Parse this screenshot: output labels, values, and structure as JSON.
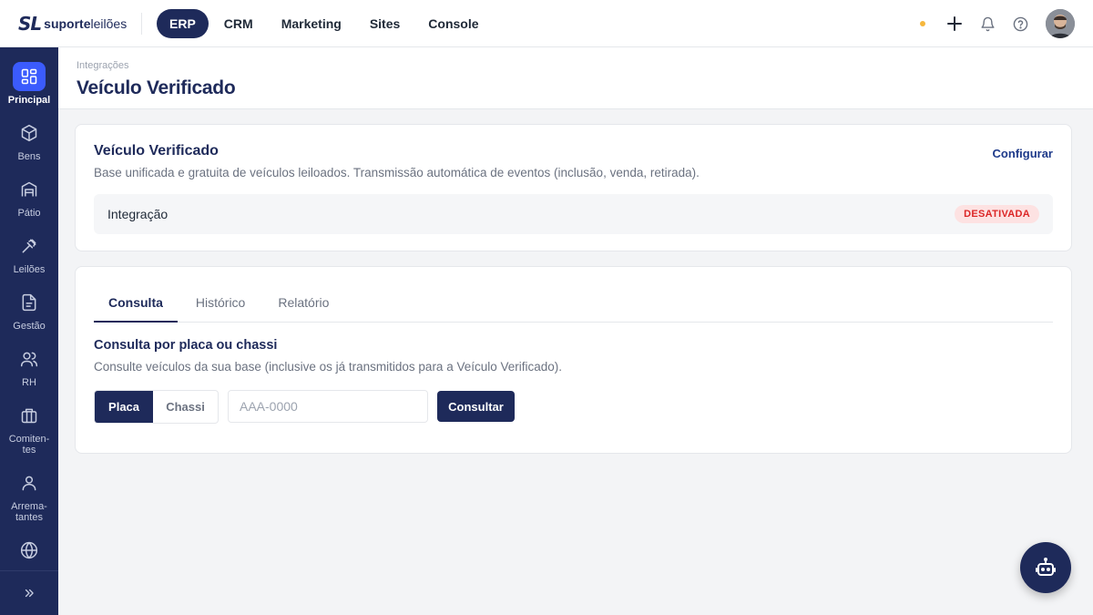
{
  "brand": {
    "mark": "SL",
    "text_bold": "suporte",
    "text_light": "leilões"
  },
  "topnav": [
    {
      "label": "ERP",
      "active": true
    },
    {
      "label": "CRM"
    },
    {
      "label": "Marketing"
    },
    {
      "label": "Sites"
    },
    {
      "label": "Console"
    }
  ],
  "sidebar": [
    {
      "label": "Principal",
      "icon": "grid-icon",
      "active": true
    },
    {
      "label": "Bens",
      "icon": "box-icon"
    },
    {
      "label": "Pátio",
      "icon": "warehouse-icon"
    },
    {
      "label": "Leilões",
      "icon": "gavel-icon"
    },
    {
      "label": "Gestão",
      "icon": "document-icon"
    },
    {
      "label": "RH",
      "icon": "users-icon"
    },
    {
      "label": "Comiten-\ntes",
      "icon": "briefcase-icon"
    },
    {
      "label": "Arrema-\ntantes",
      "icon": "user-icon"
    },
    {
      "label": "",
      "icon": "globe-icon"
    }
  ],
  "page": {
    "breadcrumb": "Integrações",
    "title": "Veículo Verificado"
  },
  "integration_card": {
    "title": "Veículo Verificado",
    "description": "Base unificada e gratuita de veículos leiloados. Transmissão automática de eventos (inclusão, venda, retirada).",
    "configure_label": "Configurar",
    "row_label": "Integração",
    "status": "DESATIVADA"
  },
  "lookup_card": {
    "tabs": [
      {
        "label": "Consulta",
        "active": true
      },
      {
        "label": "Histórico"
      },
      {
        "label": "Relatório"
      }
    ],
    "title": "Consulta por placa ou chassi",
    "description": "Consulte veículos da sua base (inclusive os já transmitidos para a Veículo Verificado).",
    "mode_options": [
      "Placa",
      "Chassi"
    ],
    "selected_mode": "Placa",
    "input_placeholder": "AAA-0000",
    "input_value": "",
    "submit_label": "Consultar"
  },
  "colors": {
    "primary": "#1e2a5a",
    "active_side": "#3b5bfd",
    "danger": "#dc2626",
    "status_dot": "#f6b73c"
  }
}
